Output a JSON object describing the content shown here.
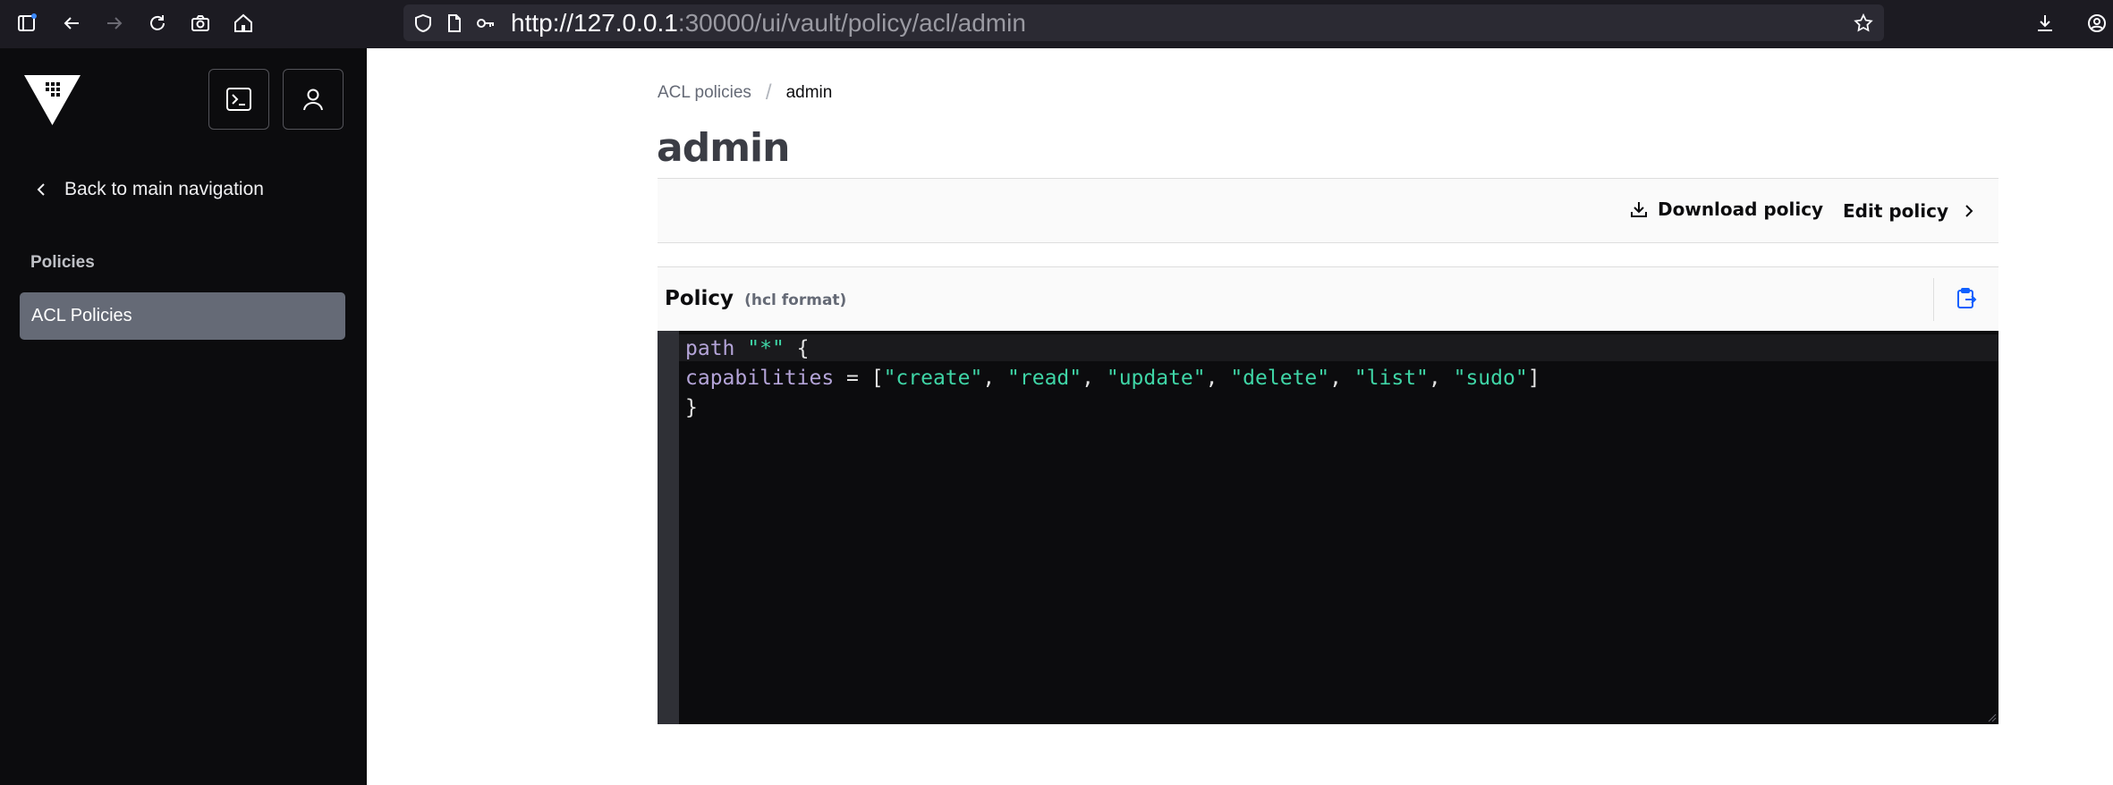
{
  "browser": {
    "url_host": "http://127.0.0.1",
    "url_rest": ":30000/ui/vault/policy/acl/admin"
  },
  "sidebar": {
    "back_label": "Back to main navigation",
    "section_title": "Policies",
    "items": [
      {
        "label": "ACL Policies",
        "active": true
      }
    ]
  },
  "breadcrumb": {
    "parent": "ACL policies",
    "separator": "/",
    "current": "admin"
  },
  "page": {
    "title": "admin"
  },
  "toolbar": {
    "download_label": "Download policy",
    "edit_label": "Edit policy"
  },
  "policy": {
    "title": "Policy",
    "format_label": "(hcl format)",
    "code": {
      "line1": {
        "keyword": "path",
        "path": "\"*\"",
        "brace": "{"
      },
      "line2": {
        "keyword": "capabilities",
        "op": " = [",
        "caps": [
          "\"create\"",
          "\"read\"",
          "\"update\"",
          "\"delete\"",
          "\"list\"",
          "\"sudo\""
        ],
        "sep": ", ",
        "end": "]"
      },
      "line3": "}"
    }
  },
  "colors": {
    "sidebar_bg": "#0c0c0e",
    "nav_active_bg": "#656a76",
    "editor_bg": "#0c0c0e",
    "code_keyword": "#b4a4d8",
    "code_string": "#3fd5a6",
    "copy_icon": "#1060ff"
  }
}
